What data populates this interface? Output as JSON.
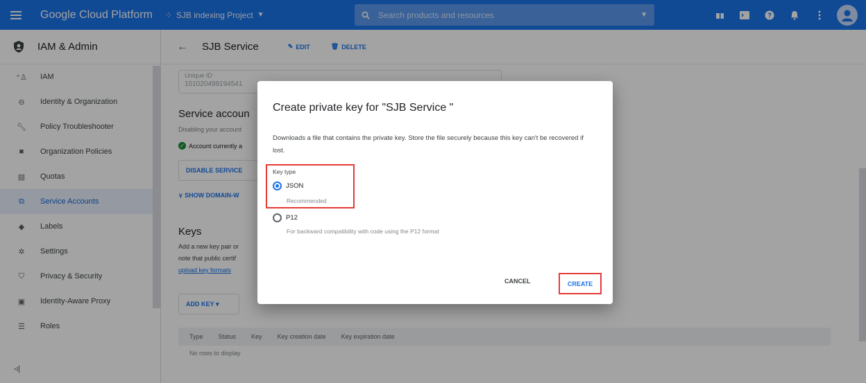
{
  "topbar": {
    "brand": "Google Cloud Platform",
    "project": "SJB indexing Project",
    "search_placeholder": "Search products and resources"
  },
  "sidebar": {
    "title": "IAM & Admin",
    "items": [
      {
        "label": "IAM",
        "icon": "person-add-icon"
      },
      {
        "label": "Identity & Organization",
        "icon": "identity-icon"
      },
      {
        "label": "Policy Troubleshooter",
        "icon": "wrench-icon"
      },
      {
        "label": "Organization Policies",
        "icon": "policy-icon"
      },
      {
        "label": "Quotas",
        "icon": "quota-icon"
      },
      {
        "label": "Service Accounts",
        "icon": "service-account-icon",
        "active": true
      },
      {
        "label": "Labels",
        "icon": "label-icon"
      },
      {
        "label": "Settings",
        "icon": "settings-icon"
      },
      {
        "label": "Privacy & Security",
        "icon": "shield-icon"
      },
      {
        "label": "Identity-Aware Proxy",
        "icon": "proxy-icon"
      },
      {
        "label": "Roles",
        "icon": "roles-icon"
      }
    ]
  },
  "main": {
    "title": "SJB Service",
    "edit_label": "EDIT",
    "delete_label": "DELETE",
    "unique_id_label": "Unique ID",
    "unique_id_value": "101020499194541",
    "sa_title": "Service accoun",
    "sa_desc": "Disabling your account",
    "sa_status": "Account currently a",
    "disable_label": "DISABLE SERVICE",
    "show_domain_label": "SHOW DOMAIN-W",
    "keys_title": "Keys",
    "keys_desc1": "Add a new key pair or",
    "keys_desc2": "note that public certif",
    "keys_link": "upload key formats",
    "add_key_label": "ADD KEY",
    "table_columns": [
      "Type",
      "Status",
      "Key",
      "Key creation date",
      "Key expiration date"
    ],
    "table_empty": "No rows to display"
  },
  "dialog": {
    "title": "Create private key for \"SJB Service \"",
    "description": "Downloads a file that contains the private key. Store the file securely because this key can't be recovered if lost.",
    "key_type_label": "Key type",
    "option_json": "JSON",
    "option_json_sub": "Recommended",
    "option_p12": "P12",
    "option_p12_sub": "For backward compatibility with code using the P12 format",
    "cancel_label": "CANCEL",
    "create_label": "CREATE"
  }
}
